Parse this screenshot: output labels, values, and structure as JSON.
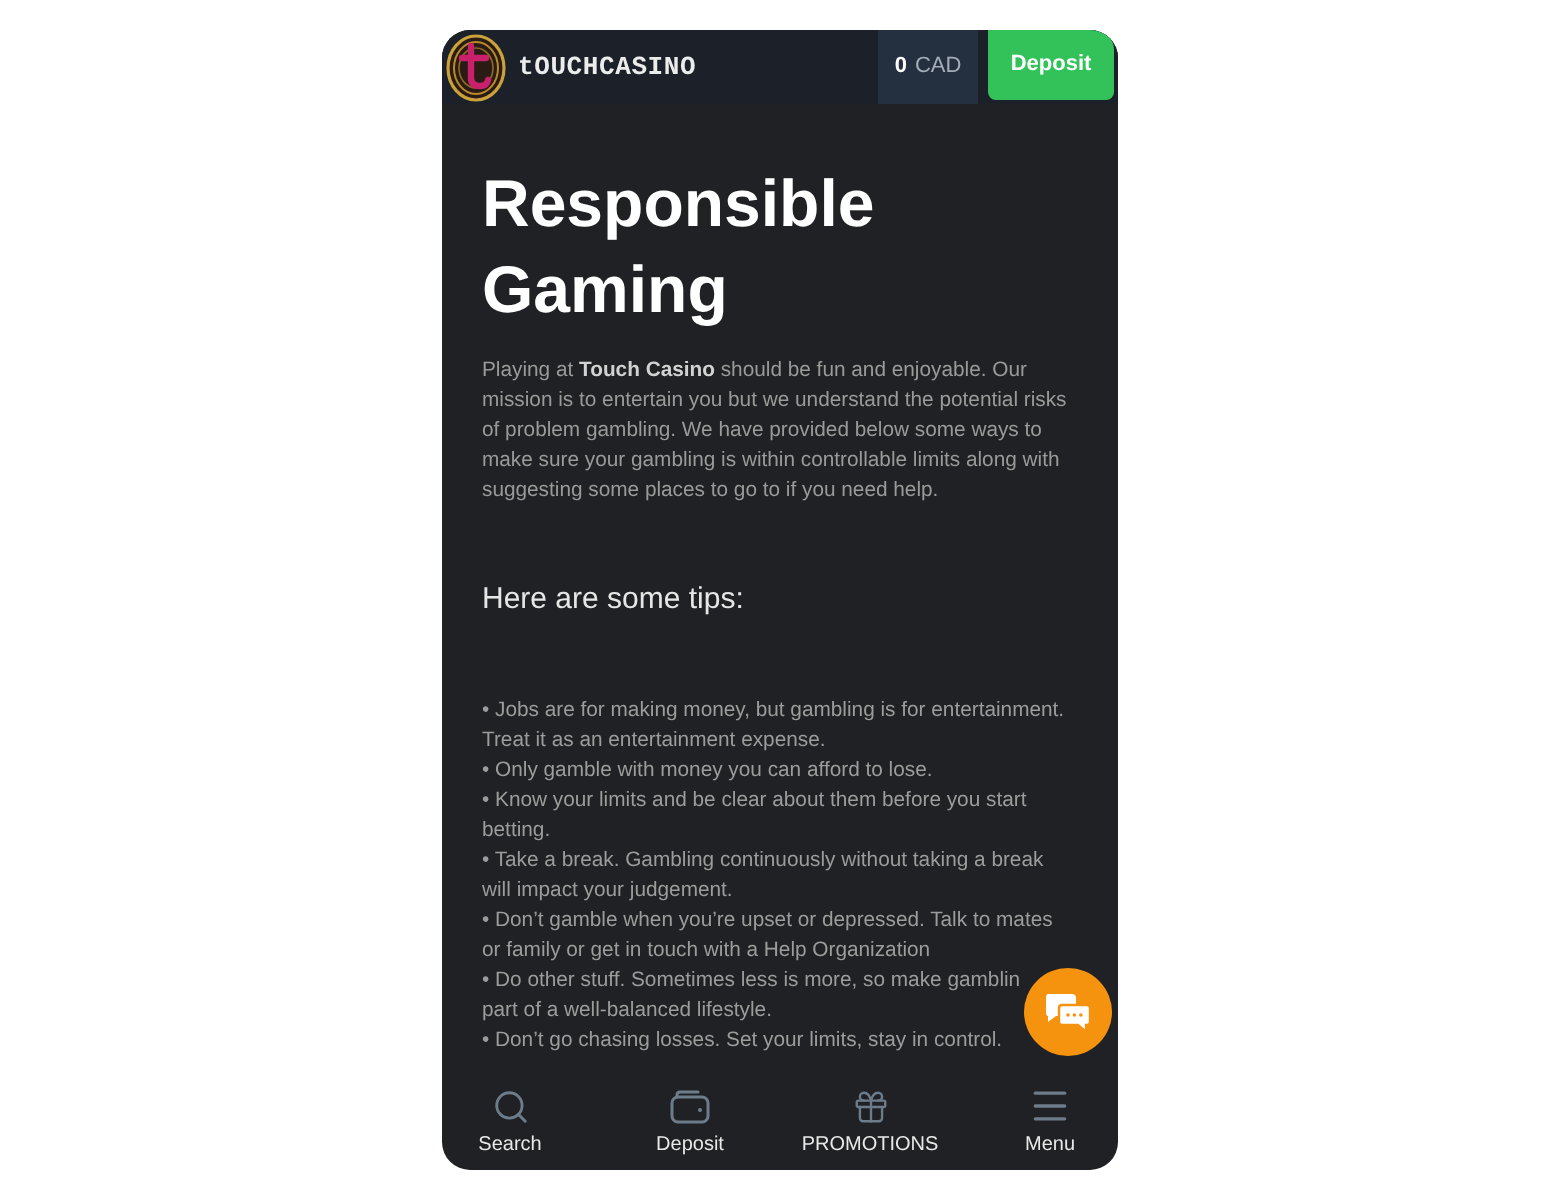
{
  "header": {
    "logo_text": "tOUCHCASINO",
    "balance": {
      "amount": "0",
      "currency": "CAD"
    },
    "deposit_label": "Deposit"
  },
  "page": {
    "title": "Responsible Gaming",
    "intro": "Playing at **Touch Casino** should be fun and enjoyable. Our mission is to entertain you but we understand the potential risks of problem gambling. We have provided below some ways to make sure your gambling is within controllable limits along with suggesting some places to go to if you need help.",
    "tips_heading": "Here are some tips:",
    "tips": [
      {
        "text": "• Jobs are for making money, but gambling is for entertainment. Treat it as an entertainment expense."
      },
      {
        "text": "• Only gamble with money you can afford to lose."
      },
      {
        "text": "• Know your limits and be clear about them before you start betting."
      },
      {
        "text": "• Take a break. Gambling continuously without taking a break will impact your judgement."
      },
      {
        "text": "• Don’t gamble when you’re upset or depressed. Talk to mates or family or get in touch with a Help Organization"
      },
      {
        "text": "• Do other stuff. Sometimes less is more, so make gamblin",
        "continuation": "part of a well-balanced lifestyle."
      },
      {
        "text": "• Don’t go chasing losses. Set your limits, stay in control."
      }
    ]
  },
  "bottom_nav": [
    {
      "label": "Search"
    },
    {
      "label": "Deposit"
    },
    {
      "label": "PROMOTIONS"
    },
    {
      "label": "Menu"
    }
  ]
}
